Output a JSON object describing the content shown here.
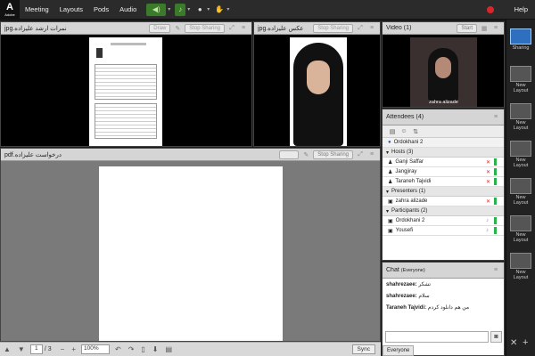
{
  "app": {
    "logo": "A",
    "logo_sub": "Adobe"
  },
  "menu": [
    "Meeting",
    "Layouts",
    "Pods",
    "Audio"
  ],
  "topbar": {
    "help": "Help"
  },
  "pods": {
    "doc1": {
      "title": "jpg.نمرات ارشد علیزاده",
      "draw": "Draw",
      "stop_sharing": "Stop Sharing"
    },
    "photo": {
      "title": "jpg.عکس علیزاده",
      "stop_sharing": "Stop Sharing"
    },
    "video": {
      "title": "Video",
      "count": "(1)",
      "start": "Start",
      "name": "zahra alizade"
    },
    "pdf": {
      "title": "pdf.درخواست علیزاده",
      "stop_sharing": "Stop Sharing"
    }
  },
  "attendees": {
    "title": "Attendees",
    "count": "(4)",
    "current_user": "Ordokhani 2",
    "sections": [
      {
        "label": "Hosts (3)",
        "members": [
          "Ganji Saffar",
          "Jangjiray",
          "Taraneh Tajvidi"
        ]
      },
      {
        "label": "Presenters (1)",
        "members": [
          "zahra alizade"
        ]
      },
      {
        "label": "Participants (2)",
        "members": [
          "Ordokhani 2",
          "Yousefi"
        ]
      }
    ]
  },
  "chat": {
    "title": "Chat",
    "scope": "(Everyone)",
    "messages": [
      {
        "sender": "shahrezaee:",
        "text": "تشکر"
      },
      {
        "sender": "shahrezaee:",
        "text": "سلام"
      },
      {
        "sender": "Taraneh Tajvidi:",
        "text": "من هم دانلود کردم"
      }
    ],
    "tab": "Everyone"
  },
  "pager": {
    "page": "1",
    "total": "/ 3",
    "zoom": "100%",
    "sync": "Sync"
  },
  "layouts": [
    "Sharing",
    "New Layout",
    "New Layout",
    "New Layout",
    "New Layout",
    "New Layout",
    "New Layout"
  ]
}
